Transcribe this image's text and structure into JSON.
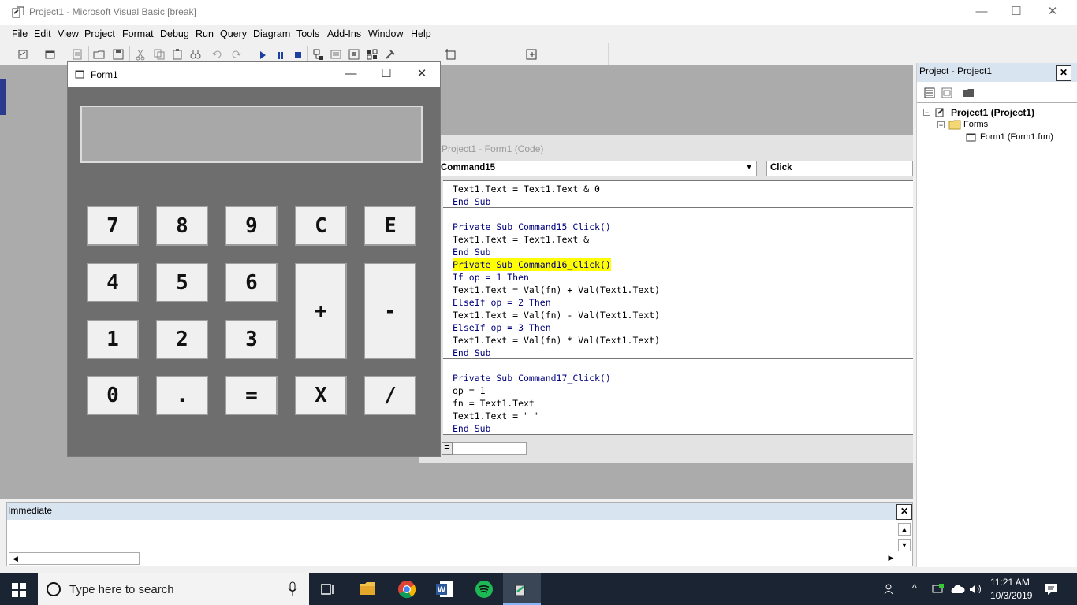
{
  "app": {
    "title": "Project1 - Microsoft Visual Basic [break]",
    "window_controls": {
      "minimize": "—",
      "maximize": "☐",
      "close": "✕"
    }
  },
  "menu": [
    "File",
    "Edit",
    "View",
    "Project",
    "Format",
    "Debug",
    "Run",
    "Query",
    "Diagram",
    "Tools",
    "Add-Ins",
    "Window",
    "Help"
  ],
  "form1": {
    "title": "Form1",
    "display_value": "",
    "keys": {
      "k7": "7",
      "k8": "8",
      "k9": "9",
      "clear": "C",
      "e": "E",
      "k4": "4",
      "k5": "5",
      "k6": "6",
      "plus": "+",
      "minus": "-",
      "k1": "1",
      "k2": "2",
      "k3": "3",
      "k0": "0",
      "dot": ".",
      "equals": "=",
      "times": "X",
      "divide": "/"
    }
  },
  "code_window": {
    "title": "Project1 - Form1 (Code)",
    "object_combo": "Command15",
    "proc_combo": "Click",
    "lines": {
      "l1": "Text1.Text = Text1.Text & 0",
      "l2": "End Sub",
      "l3": "Private Sub Command15_Click()",
      "l4": "Text1.Text = Text1.Text &",
      "l5": "End Sub",
      "l6": "Private Sub Command16_Click()",
      "l7": "If op = 1 Then",
      "l8": "Text1.Text = Val(fn) + Val(Text1.Text)",
      "l9": "ElseIf op = 2 Then",
      "l10": "Text1.Text = Val(fn) - Val(Text1.Text)",
      "l11": "ElseIf op = 3 Then",
      "l12": "Text1.Text = Val(fn) * Val(Text1.Text)",
      "l13": "End Sub",
      "l14": "Private Sub Command17_Click()",
      "l15": "op = 1",
      "l16": "fn = Text1.Text",
      "l17": "Text1.Text = \" \"",
      "l18": "End Sub"
    }
  },
  "project_pane": {
    "title": "Project - Project1",
    "tree": {
      "project": "Project1 (Project1)",
      "forms": "Forms",
      "form1": "Form1 (Form1.frm)"
    }
  },
  "immediate": {
    "title": "Immediate"
  },
  "taskbar": {
    "search_placeholder": "Type here to search",
    "time": "11:21 AM",
    "date": "10/3/2019"
  },
  "colors": {
    "highlight": "#ffff00",
    "keyword": "#00007f",
    "taskbar": "#1b2432"
  }
}
